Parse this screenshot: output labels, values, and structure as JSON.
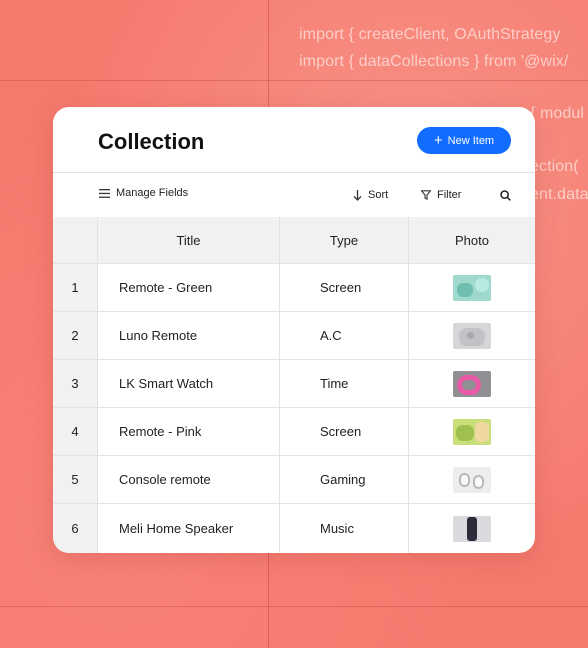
{
  "background": {
    "code_lines": [
      "import { createClient, OAuthStrategy",
      "import { dataCollections } from '@wix/",
      "{ modul",
      "ection(",
      "ent.data"
    ],
    "colors": {
      "base": "#f57a6e",
      "grid": "#be3c3c"
    }
  },
  "panel": {
    "title": "Collection",
    "new_item_label": "New Item",
    "accent": "#116dff"
  },
  "toolbar": {
    "manage_fields": "Manage Fields",
    "sort": "Sort",
    "filter": "Filter"
  },
  "table": {
    "columns": [
      "Title",
      "Type",
      "Photo"
    ],
    "rows": [
      {
        "num": "1",
        "title": "Remote - Green",
        "type": "Screen",
        "photo": "mint-remote-thumbnail"
      },
      {
        "num": "2",
        "title": "Luno Remote",
        "type": "A.C",
        "photo": "grey-remote-thumbnail"
      },
      {
        "num": "3",
        "title": "LK Smart Watch",
        "type": "Time",
        "photo": "pink-watch-thumbnail"
      },
      {
        "num": "4",
        "title": "Remote - Pink",
        "type": "Screen",
        "photo": "lime-remote-thumbnail"
      },
      {
        "num": "5",
        "title": "Console remote",
        "type": "Gaming",
        "photo": "white-earbuds-thumbnail"
      },
      {
        "num": "6",
        "title": "Meli Home Speaker",
        "type": "Music",
        "photo": "dark-speaker-thumbnail"
      }
    ]
  }
}
